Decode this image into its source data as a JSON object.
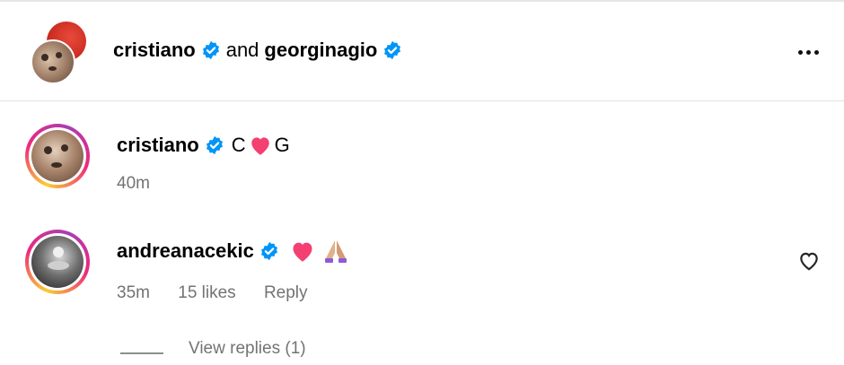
{
  "header": {
    "user1": "cristiano",
    "conjunction": "and",
    "user2": "georginagio"
  },
  "comments": [
    {
      "username": "cristiano",
      "verified": true,
      "text_before": "C",
      "text_emoji": "❤",
      "text_after": "G",
      "time": "40m"
    },
    {
      "username": "andreanacekic",
      "verified": true,
      "text_emoji_1": "❤",
      "text_emoji_2": "🙏",
      "time": "35m",
      "likes": "15 likes",
      "reply_label": "Reply"
    }
  ],
  "view_replies": "View replies (1)",
  "colors": {
    "verified_blue": "#0095f6",
    "heart_pink": "#f43f72",
    "meta_gray": "#737373"
  },
  "icons": [
    "verified-badge-icon",
    "more-options-icon",
    "heart-icon",
    "prayer-hands-icon"
  ]
}
